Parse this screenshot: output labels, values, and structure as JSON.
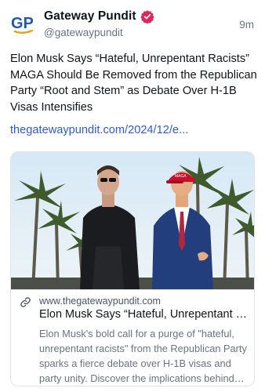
{
  "post": {
    "author": {
      "display_name": "Gateway Pundit",
      "handle": "@gatewaypundit",
      "avatar_initials": "GP",
      "verified": true
    },
    "timestamp": "9m",
    "text": "Elon Musk Says “Hateful, Unrepentant Racists” MAGA Should Be Removed from the Republican Party “Root and Stem” as Debate Over H-1B Visas Intensifies",
    "link_text": "thegatewaypundit.com/2024/12/e..."
  },
  "card": {
    "domain": "www.thegatewaypundit.com",
    "title": "Elon Musk Says “Hateful, Unrepentant Racists” MAGA Should Be Removed",
    "description": "Elon Musk's bold call for a purge of \"hateful, unrepentant racists\" from the Republican Party sparks a fierce debate over H-1B visas and party unity. Discover the implications behind this controversial statement.",
    "image_icon": "photo-two-men-walking"
  },
  "colors": {
    "link": "#2f5bd3",
    "verified_badge": "#e0245e",
    "avatar_brand": "#1f5aa6",
    "avatar_accent": "#e8a317"
  }
}
